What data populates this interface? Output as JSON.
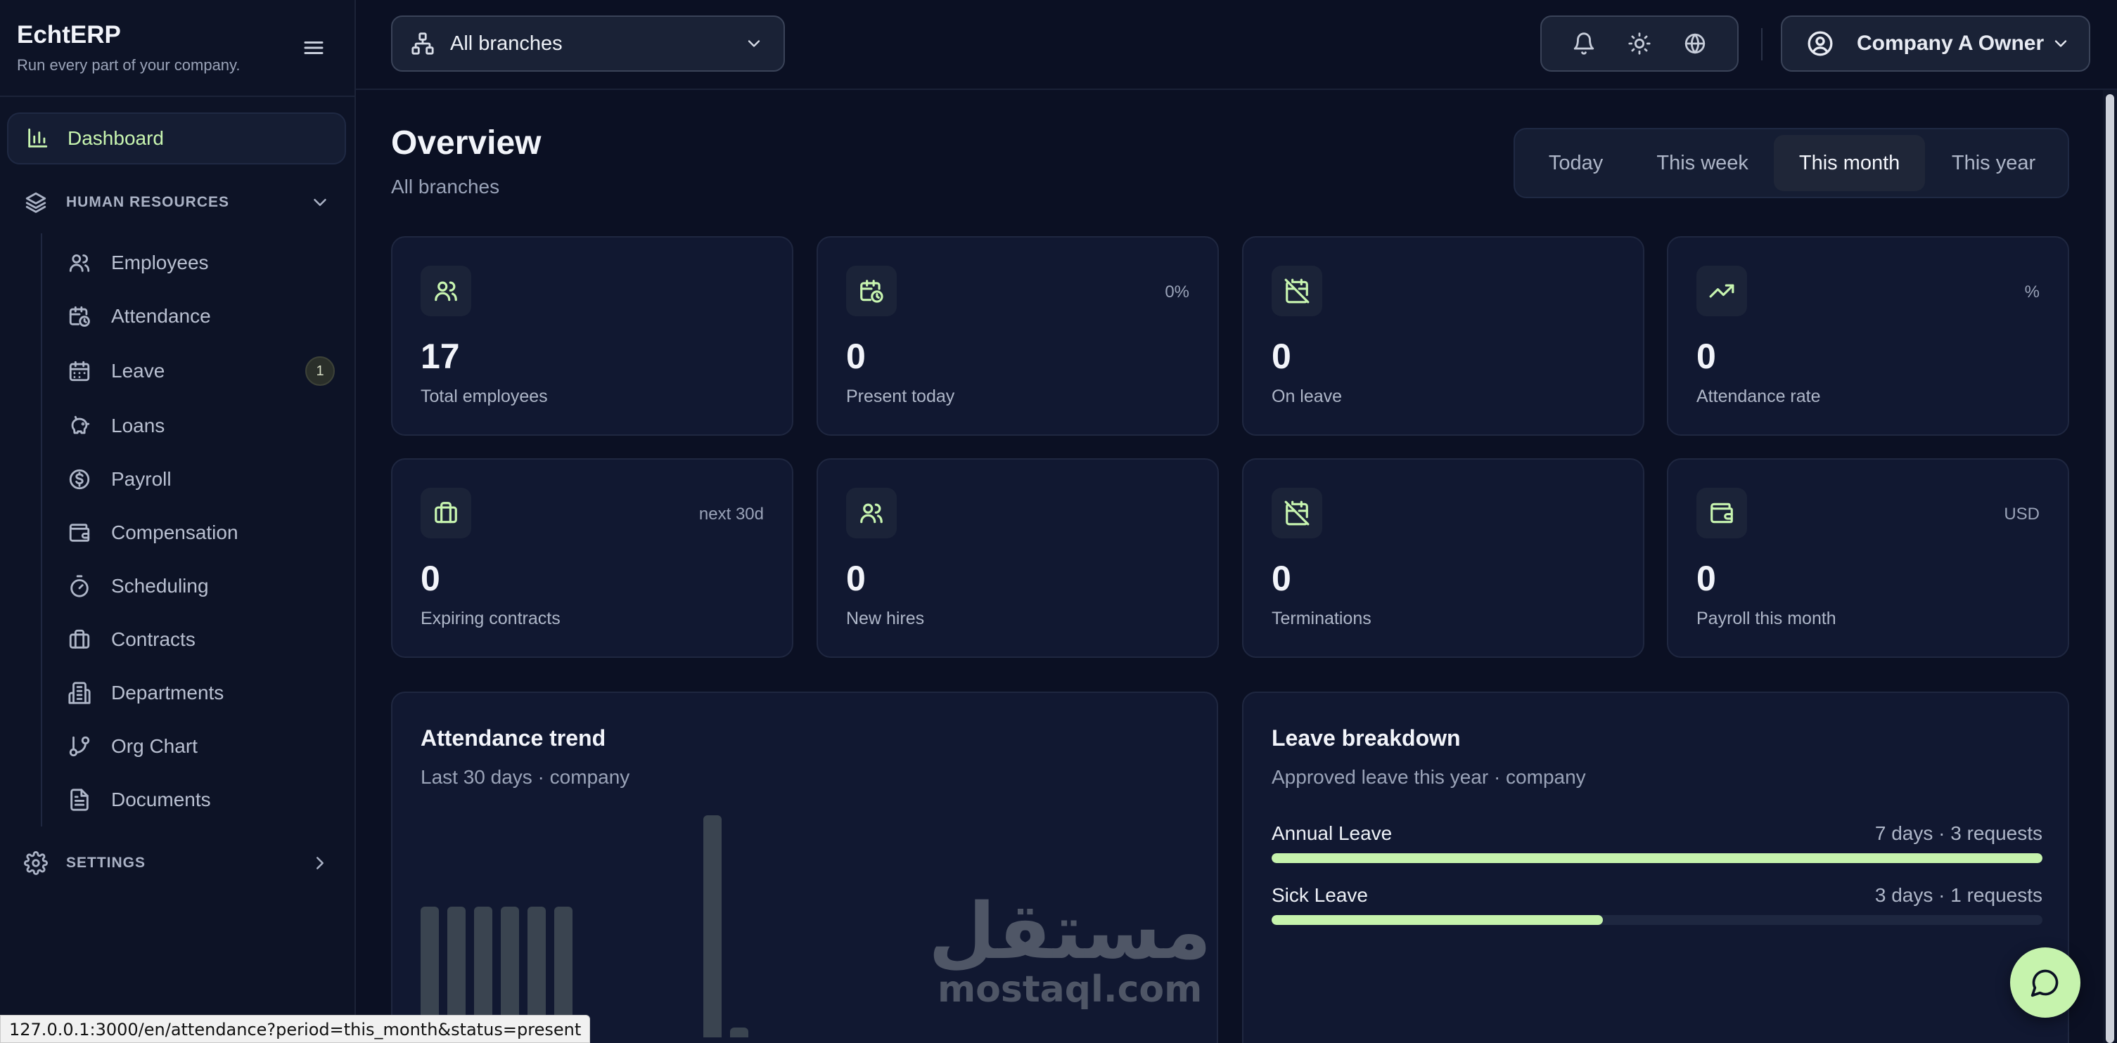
{
  "brand": {
    "name": "EchtERP",
    "tagline": "Run every part of your company."
  },
  "sidebar": {
    "dashboard_label": "Dashboard",
    "group_label": "HUMAN RESOURCES",
    "items": [
      {
        "label": "Employees",
        "icon": "users-icon"
      },
      {
        "label": "Attendance",
        "icon": "calendar-clock-icon"
      },
      {
        "label": "Leave",
        "icon": "calendar-icon",
        "badge": "1"
      },
      {
        "label": "Loans",
        "icon": "piggy-bank-icon"
      },
      {
        "label": "Payroll",
        "icon": "dollar-circle-icon"
      },
      {
        "label": "Compensation",
        "icon": "wallet-icon"
      },
      {
        "label": "Scheduling",
        "icon": "timer-icon"
      },
      {
        "label": "Contracts",
        "icon": "briefcase-icon"
      },
      {
        "label": "Departments",
        "icon": "building-icon"
      },
      {
        "label": "Org Chart",
        "icon": "git-branch-icon"
      },
      {
        "label": "Documents",
        "icon": "file-text-icon"
      }
    ],
    "settings_label": "SETTINGS"
  },
  "header": {
    "branch_select": "All branches",
    "user": "Company A Owner"
  },
  "overview": {
    "title": "Overview",
    "subtitle": "All branches",
    "periods": [
      "Today",
      "This week",
      "This month",
      "This year"
    ],
    "active_period": "This month"
  },
  "stats": [
    {
      "value": "17",
      "label": "Total employees",
      "meta": "",
      "icon": "users-icon"
    },
    {
      "value": "0",
      "label": "Present today",
      "meta": "0%",
      "icon": "calendar-clock-icon"
    },
    {
      "value": "0",
      "label": "On leave",
      "meta": "",
      "icon": "calendar-off-icon"
    },
    {
      "value": "0",
      "label": "Attendance rate",
      "meta": "%",
      "icon": "trending-up-icon"
    },
    {
      "value": "0",
      "label": "Expiring contracts",
      "meta": "next 30d",
      "icon": "briefcase-icon"
    },
    {
      "value": "0",
      "label": "New hires",
      "meta": "",
      "icon": "users-icon"
    },
    {
      "value": "0",
      "label": "Terminations",
      "meta": "",
      "icon": "calendar-off-icon"
    },
    {
      "value": "0",
      "label": "Payroll this month",
      "meta": "USD",
      "icon": "wallet-icon"
    }
  ],
  "attendance": {
    "title": "Attendance trend",
    "subtitle": "Last 30 days · company"
  },
  "leave": {
    "title": "Leave breakdown",
    "subtitle": "Approved leave this year · company",
    "rows": [
      {
        "name": "Annual Leave",
        "stat": "7 days · 3 requests",
        "fraction": 1.0
      },
      {
        "name": "Sick Leave",
        "stat": "3 days · 1 requests",
        "fraction": 0.43
      }
    ]
  },
  "watermark": {
    "arabic": "مستقل",
    "latin": "mostaql.com"
  },
  "status_url": "127.0.0.1:3000/en/attendance?period=this_month&status=present",
  "colors": {
    "accent": "#c6f3ad",
    "background": "#0b1023",
    "card": "#111831"
  }
}
